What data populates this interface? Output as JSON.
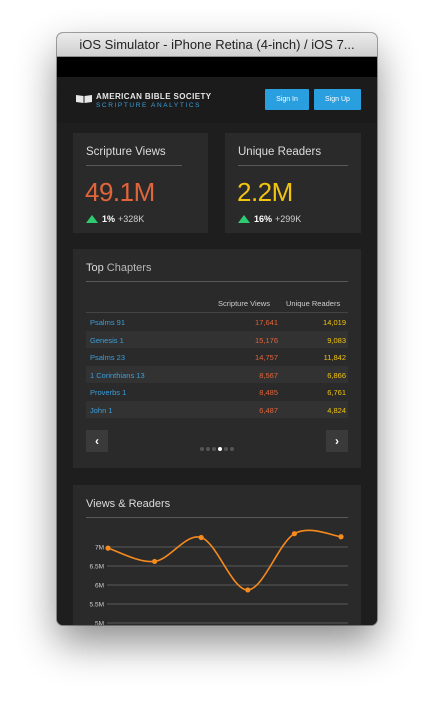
{
  "window": {
    "title": "iOS Simulator - iPhone Retina (4-inch) / iOS 7..."
  },
  "header": {
    "brand_title": "AMERICAN BIBLE SOCIETY",
    "brand_subtitle": "SCRIPTURE ANALYTICS",
    "signin_label": "Sign In",
    "signup_label": "Sign Up",
    "accent_color": "#2a9fe0"
  },
  "stats": [
    {
      "title": "Scripture Views",
      "value": "49.1M",
      "change_pct": "1%",
      "change_abs": "+328K",
      "color": "#e2643b"
    },
    {
      "title": "Unique Readers",
      "value": "2.2M",
      "change_pct": "16%",
      "change_abs": "+299K",
      "color": "#f1c40f"
    }
  ],
  "top_chapters": {
    "title_bold": "Top",
    "title_rest": " Chapters",
    "col_views": "Scripture Views",
    "col_readers": "Unique Readers",
    "rows": [
      {
        "chapter": "Psalms 91",
        "views": "17,641",
        "readers": "14,019"
      },
      {
        "chapter": "Genesis 1",
        "views": "15,176",
        "readers": "9,083"
      },
      {
        "chapter": "Psalms 23",
        "views": "14,757",
        "readers": "11,842"
      },
      {
        "chapter": "1 Corinthians 13",
        "views": "8,567",
        "readers": "6,866"
      },
      {
        "chapter": "Proverbs 1",
        "views": "8,485",
        "readers": "6,761"
      },
      {
        "chapter": "John 1",
        "views": "6,487",
        "readers": "4,824"
      }
    ],
    "prev_icon": "chevron-left-icon",
    "next_icon": "chevron-right-icon",
    "page_count": 6,
    "active_page": 4
  },
  "views_chart": {
    "title": "Views & Readers",
    "line_color": "#f58a1f"
  },
  "chart_data": {
    "type": "line",
    "title": "Views & Readers",
    "y_ticks": [
      "7M",
      "6.5M",
      "6M",
      "5.5M",
      "5M"
    ],
    "ylim": [
      5,
      7.5
    ],
    "series": [
      {
        "values": [
          6.97,
          6.62,
          7.25,
          5.87,
          7.35,
          7.27
        ]
      }
    ]
  }
}
